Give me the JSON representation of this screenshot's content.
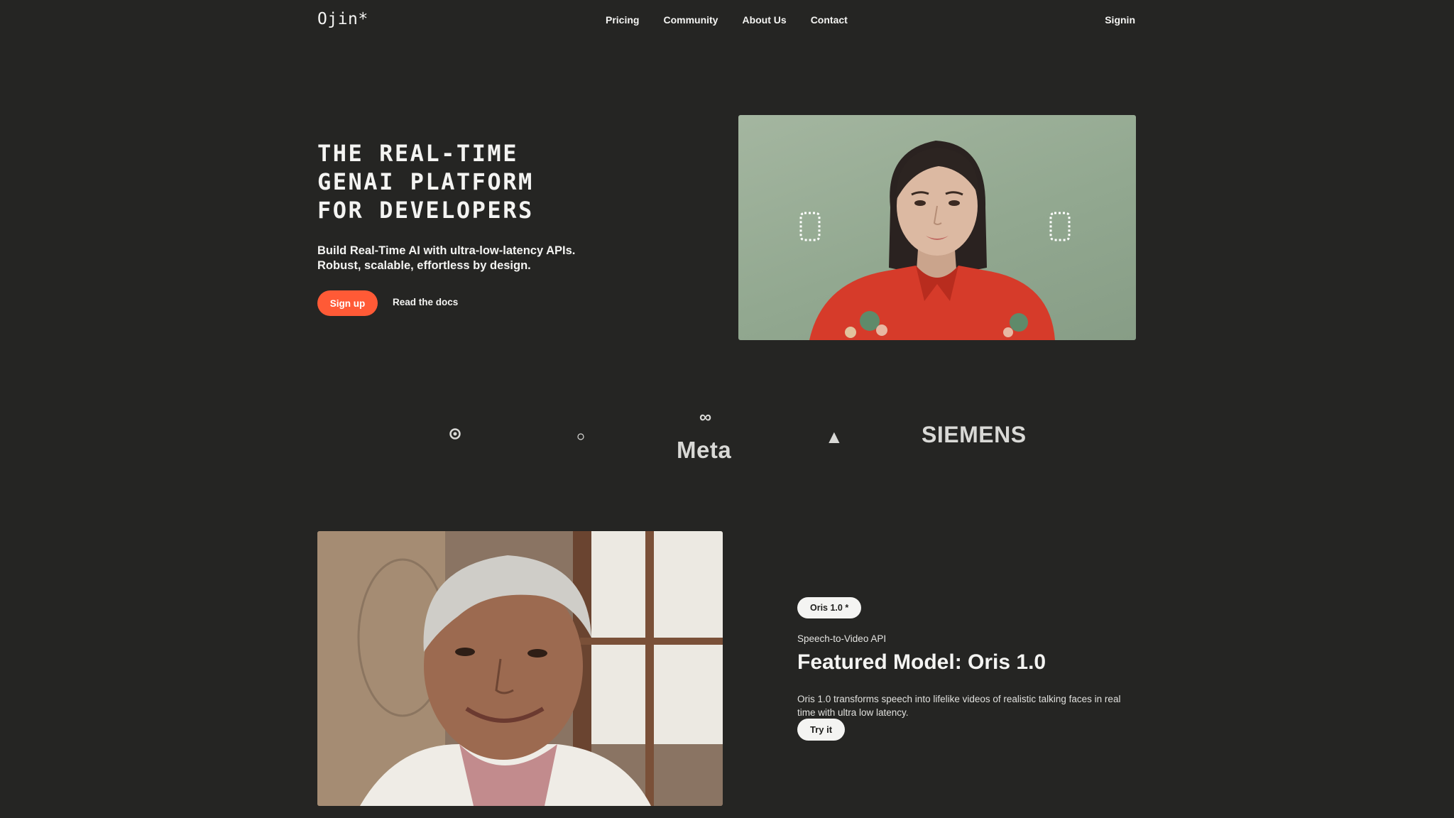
{
  "nav": {
    "logo": "Ojin*",
    "links": [
      {
        "label": "Pricing"
      },
      {
        "label": "Community"
      },
      {
        "label": "About Us"
      },
      {
        "label": "Contact"
      }
    ],
    "signin": "Signin"
  },
  "hero": {
    "title_lines": [
      "THE REAL-TIME",
      "GENAI PLATFORM",
      "FOR DEVELOPERS"
    ],
    "subtitle_lines": [
      "Build Real-Time AI with ultra-low-latency APIs.",
      "Robust, scalable, effortless by design."
    ],
    "signup_label": "Sign up",
    "docs_label": "Read the docs"
  },
  "logos": {
    "meta_symbol": "∞",
    "meta": "Meta",
    "triangle": "▲",
    "siemens": "SIEMENS"
  },
  "feature": {
    "badge": "Oris 1.0 *",
    "eyebrow": "Speech-to-Video API",
    "title": "Featured Model: Oris 1.0",
    "description": "Oris 1.0 transforms speech into lifelike videos of realistic talking faces in real time with ultra low latency.",
    "try_label": "Try it"
  },
  "colors": {
    "background": "#252523",
    "accent": "#ff5a36",
    "text": "#f4f4f2"
  }
}
